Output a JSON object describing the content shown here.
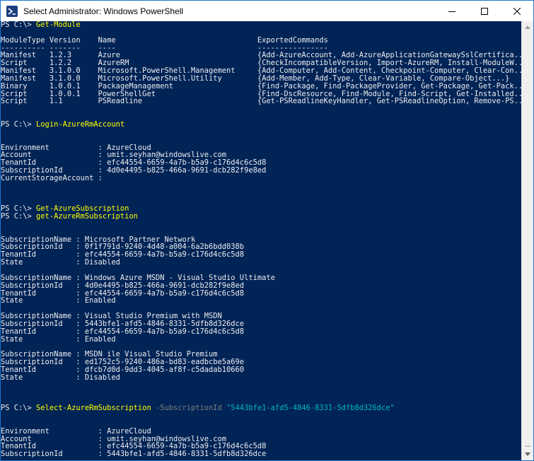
{
  "window": {
    "title": "Select Administrator: Windows PowerShell",
    "icon": "powershell-icon",
    "controls": [
      "minimize-icon",
      "maximize-icon",
      "close-icon"
    ]
  },
  "colors": {
    "console_bg": "#012456",
    "text": "#eeedf0",
    "command": "#ffff00",
    "parameter": "#7f7f7f",
    "string": "#00b7c3"
  },
  "console": {
    "lines": [
      [
        {
          "t": "PS C:\\> "
        },
        {
          "t": "Get-Module",
          "c": "cmd"
        }
      ],
      [
        {
          "t": ""
        }
      ],
      [
        {
          "t": "ModuleType Version    Name                                ExportedCommands"
        }
      ],
      [
        {
          "t": "---------- -------    ----                                ----------------"
        }
      ],
      [
        {
          "t": "Manifest   1.2.3      Azure                               {Add-AzureAccount, Add-AzureApplicationGatewaySslCertifica..."
        }
      ],
      [
        {
          "t": "Script     1.2.2      AzureRM                             {CheckIncompatibleVersion, Import-AzureRM, Install-ModuleW..."
        }
      ],
      [
        {
          "t": "Manifest   3.1.0.0    Microsoft.PowerShell.Management     {Add-Computer, Add-Content, Checkpoint-Computer, Clear-Con..."
        }
      ],
      [
        {
          "t": "Manifest   3.1.0.0    Microsoft.PowerShell.Utility        {Add-Member, Add-Type, Clear-Variable, Compare-Object...}"
        }
      ],
      [
        {
          "t": "Binary     1.0.0.1    PackageManagement                   {Find-Package, Find-PackageProvider, Get-Package, Get-Pack..."
        }
      ],
      [
        {
          "t": "Script     1.0.0.1    PowerShellGet                       {Find-DscResource, Find-Module, Find-Script, Get-Installed..."
        }
      ],
      [
        {
          "t": "Script     1.1        PSReadline                          {Get-PSReadlineKeyHandler, Get-PSReadlineOption, Remove-PS..."
        }
      ],
      [
        {
          "t": ""
        }
      ],
      [
        {
          "t": ""
        }
      ],
      [
        {
          "t": "PS C:\\> "
        },
        {
          "t": "Login-AzureRmAccount",
          "c": "cmd"
        }
      ],
      [
        {
          "t": ""
        }
      ],
      [
        {
          "t": ""
        }
      ],
      [
        {
          "t": "Environment           : AzureCloud"
        }
      ],
      [
        {
          "t": "Account               : umit.seyhan@windowslive.com"
        }
      ],
      [
        {
          "t": "TenantId              : efc44554-6659-4a7b-b5a9-c176d4c6c5d8"
        }
      ],
      [
        {
          "t": "SubscriptionId        : 4d0e4495-b825-466a-9691-dcb282f9e8ed"
        }
      ],
      [
        {
          "t": "CurrentStorageAccount :"
        }
      ],
      [
        {
          "t": ""
        }
      ],
      [
        {
          "t": ""
        }
      ],
      [
        {
          "t": ""
        }
      ],
      [
        {
          "t": "PS C:\\> "
        },
        {
          "t": "Get-AzureSubscription",
          "c": "cmd"
        }
      ],
      [
        {
          "t": "PS C:\\> "
        },
        {
          "t": "get-AzureRmSubscription",
          "c": "cmd"
        }
      ],
      [
        {
          "t": ""
        }
      ],
      [
        {
          "t": ""
        }
      ],
      [
        {
          "t": "SubscriptionName : Microsoft Partner Network"
        }
      ],
      [
        {
          "t": "SubscriptionId   : 0f1f791d-9240-4d48-a004-6a2b6bdd038b"
        }
      ],
      [
        {
          "t": "TenantId         : efc44554-6659-4a7b-b5a9-c176d4c6c5d8"
        }
      ],
      [
        {
          "t": "State            : Disabled"
        }
      ],
      [
        {
          "t": ""
        }
      ],
      [
        {
          "t": "SubscriptionName : Windows Azure MSDN - Visual Studio Ultimate"
        }
      ],
      [
        {
          "t": "SubscriptionId   : 4d0e4495-b825-466a-9691-dcb282f9e8ed"
        }
      ],
      [
        {
          "t": "TenantId         : efc44554-6659-4a7b-b5a9-c176d4c6c5d8"
        }
      ],
      [
        {
          "t": "State            : Enabled"
        }
      ],
      [
        {
          "t": ""
        }
      ],
      [
        {
          "t": "SubscriptionName : Visual Studio Premium with MSDN"
        }
      ],
      [
        {
          "t": "SubscriptionId   : 5443bfe1-afd5-4846-8331-5dfb8d326dce"
        }
      ],
      [
        {
          "t": "TenantId         : efc44554-6659-4a7b-b5a9-c176d4c6c5d8"
        }
      ],
      [
        {
          "t": "State            : Enabled"
        }
      ],
      [
        {
          "t": ""
        }
      ],
      [
        {
          "t": "SubscriptionName : MSDN ile Visual Studio Premium"
        }
      ],
      [
        {
          "t": "SubscriptionId   : ed1752c5-9240-486a-bd83-eadbcbe5a69e"
        }
      ],
      [
        {
          "t": "TenantId         : dfcb7d0d-9dd3-4045-af8f-c5dadab10660"
        }
      ],
      [
        {
          "t": "State            : Disabled"
        }
      ],
      [
        {
          "t": ""
        }
      ],
      [
        {
          "t": ""
        }
      ],
      [
        {
          "t": ""
        }
      ],
      [
        {
          "t": "PS C:\\> "
        },
        {
          "t": "Select-AzureRmSubscription",
          "c": "cmd"
        },
        {
          "t": " -SubscriptionId",
          "c": "param"
        },
        {
          "t": " \"5443bfe1-afd5-4846-8331-5dfb8d326dce\"",
          "c": "str"
        }
      ],
      [
        {
          "t": ""
        }
      ],
      [
        {
          "t": ""
        }
      ],
      [
        {
          "t": "Environment           : AzureCloud"
        }
      ],
      [
        {
          "t": "Account               : umit.seyhan@windowslive.com"
        }
      ],
      [
        {
          "t": "TenantId              : efc44554-6659-4a7b-b5a9-c176d4c6c5d8"
        }
      ],
      [
        {
          "t": "SubscriptionId        : 5443bfe1-afd5-4846-8331-5dfb8d326dce"
        }
      ]
    ]
  }
}
